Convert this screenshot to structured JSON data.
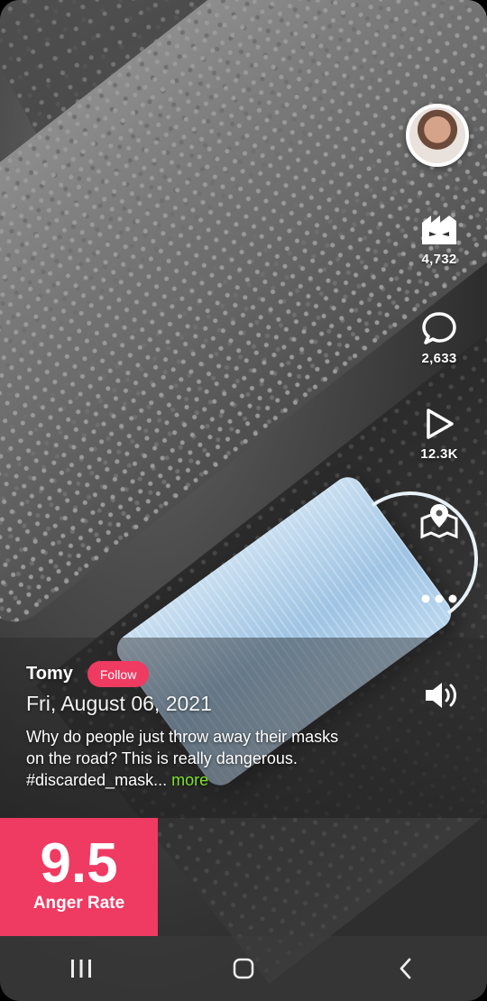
{
  "post": {
    "username": "Tomy",
    "follow_label": "Follow",
    "date": "Fri, August 06, 2021",
    "caption": "Why do people just throw away their masks on the road? This is really dangerous. #discarded_mask...",
    "more_label": " more"
  },
  "actions": {
    "angry": {
      "icon": "angry-factory-icon",
      "count": "4,732"
    },
    "comment": {
      "icon": "comment-bubble-icon",
      "count": "2,633"
    },
    "play": {
      "icon": "play-icon",
      "count": "12.3K"
    },
    "map": {
      "icon": "map-pin-icon"
    },
    "more": {
      "icon": "more-dots-icon"
    },
    "sound": {
      "icon": "speaker-icon"
    }
  },
  "anger_rate": {
    "value": "9.5",
    "label": "Anger Rate",
    "color": "#ef3a62"
  },
  "nav": {
    "recents": "recents-icon",
    "home": "home-icon",
    "back": "back-icon"
  }
}
